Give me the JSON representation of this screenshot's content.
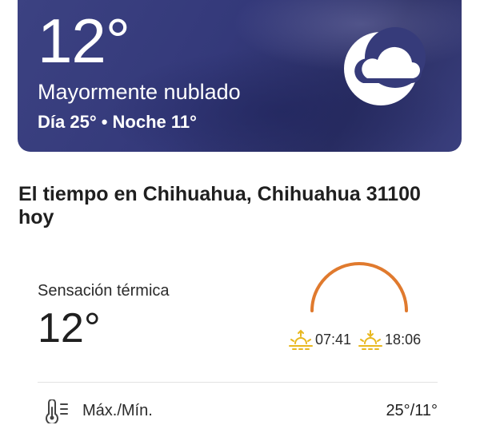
{
  "current": {
    "temperature": "12°",
    "condition": "Mayormente nublado",
    "day_night": "Día 25° • Noche 11°",
    "icon": "partly-cloudy-night-icon"
  },
  "location": {
    "title": "El tiempo en Chihuahua, Chihuahua 31100 hoy"
  },
  "feels_like": {
    "label": "Sensación térmica",
    "value": "12°"
  },
  "sun": {
    "sunrise": "07:41",
    "sunset": "18:06",
    "arc_color": "#e07a2e",
    "icon_color": "#e8b820"
  },
  "details": {
    "max_min_label": "Máx./Mín.",
    "max_min_value": "25°/11°",
    "icon": "thermometer-icon"
  }
}
